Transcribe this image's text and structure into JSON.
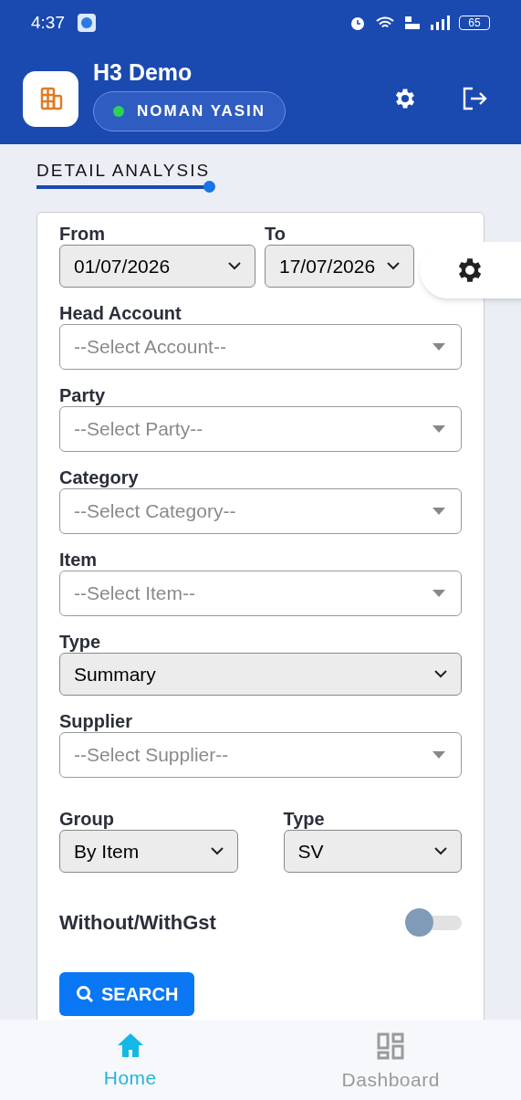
{
  "status_bar": {
    "time": "4:37",
    "battery": "65"
  },
  "header": {
    "title": "H3 Demo",
    "user": "NOMAN YASIN",
    "online": true
  },
  "section_title": "DETAIL ANALYSIS",
  "form": {
    "rows": [
      {
        "fields": [
          {
            "label": "From",
            "kind": "select",
            "value": "01/07/2026"
          },
          {
            "label": "To",
            "kind": "select",
            "value": "17/07/2026"
          }
        ]
      },
      {
        "fields": [
          {
            "label": "Head Account",
            "kind": "dropdown",
            "placeholder": "--Select Account--"
          }
        ]
      },
      {
        "fields": [
          {
            "label": "Party",
            "kind": "dropdown",
            "placeholder": "--Select Party--"
          }
        ]
      },
      {
        "fields": [
          {
            "label": "Category",
            "kind": "dropdown",
            "placeholder": "--Select Category--"
          }
        ]
      },
      {
        "fields": [
          {
            "label": "Item",
            "kind": "dropdown",
            "placeholder": "--Select Item--"
          }
        ]
      },
      {
        "fields": [
          {
            "label": "Type",
            "kind": "select",
            "value": "Summary"
          }
        ]
      },
      {
        "fields": [
          {
            "label": "Supplier",
            "kind": "dropdown",
            "placeholder": "--Select Supplier--"
          }
        ]
      },
      {
        "fields": [
          {
            "label": "Group",
            "kind": "select",
            "value": "By Item"
          },
          {
            "label": "Type",
            "kind": "select",
            "value": "SV"
          }
        ]
      }
    ],
    "toggle": {
      "label": "Without/WithGst",
      "on": false
    },
    "search_button": "SEARCH"
  },
  "bottom_nav": [
    {
      "label": "Home",
      "selected": true
    },
    {
      "label": "Dashboard",
      "selected": false
    }
  ]
}
